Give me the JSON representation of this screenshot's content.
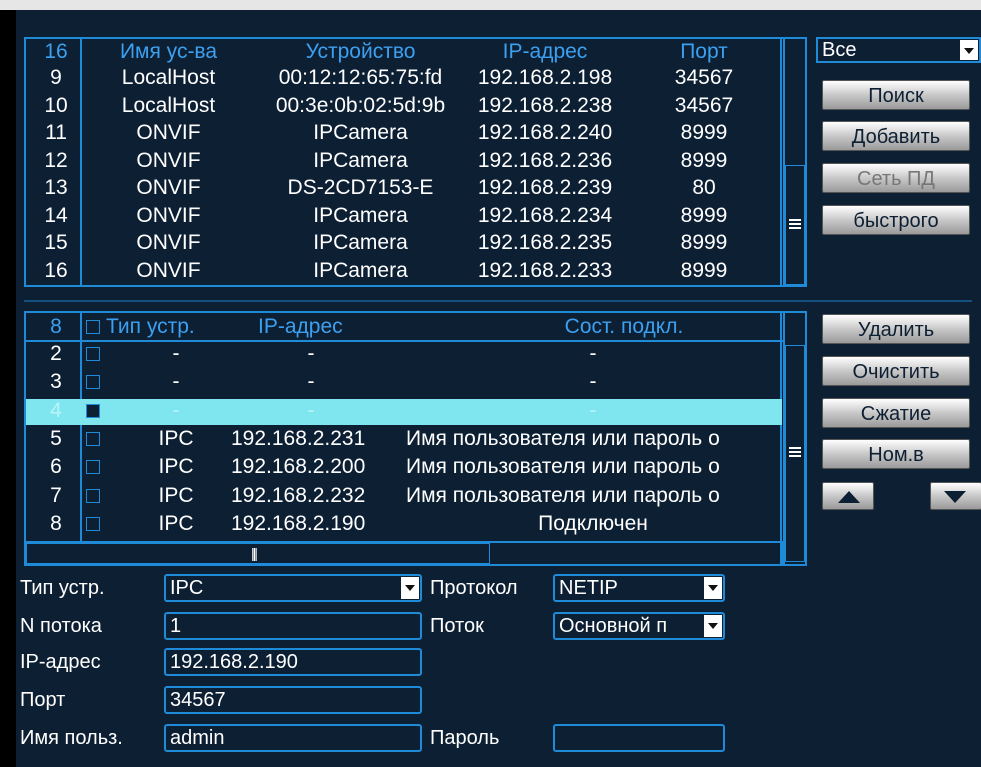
{
  "search_table": {
    "headers": {
      "num": "16",
      "name": "Имя ус-ва",
      "device": "Устройство",
      "ip": "IP-адрес",
      "port": "Порт"
    },
    "rows": [
      {
        "num": "9",
        "name": "LocalHost",
        "device": "00:12:12:65:75:fd",
        "ip": "192.168.2.198",
        "port": "34567"
      },
      {
        "num": "10",
        "name": "LocalHost",
        "device": "00:3e:0b:02:5d:9b",
        "ip": "192.168.2.238",
        "port": "34567"
      },
      {
        "num": "11",
        "name": "ONVIF",
        "device": "IPCamera",
        "ip": "192.168.2.240",
        "port": "8999"
      },
      {
        "num": "12",
        "name": "ONVIF",
        "device": "IPCamera",
        "ip": "192.168.2.236",
        "port": "8999"
      },
      {
        "num": "13",
        "name": "ONVIF",
        "device": "DS-2CD7153-E",
        "ip": "192.168.2.239",
        "port": "80"
      },
      {
        "num": "14",
        "name": "ONVIF",
        "device": "IPCamera",
        "ip": "192.168.2.234",
        "port": "8999"
      },
      {
        "num": "15",
        "name": "ONVIF",
        "device": "IPCamera",
        "ip": "192.168.2.235",
        "port": "8999"
      },
      {
        "num": "16",
        "name": "ONVIF",
        "device": "IPCamera",
        "ip": "192.168.2.233",
        "port": "8999"
      }
    ]
  },
  "right_top": {
    "filter_value": "Все",
    "search_label": "Поиск",
    "add_label": "Добавить",
    "network_label": "Сеть ПД",
    "quick_label": "быстрого"
  },
  "added_table": {
    "headers": {
      "num": "8",
      "type": "Тип устр.",
      "ip": "IP-адрес",
      "status": "Сост. подкл."
    },
    "rows": [
      {
        "num": "2",
        "type": "-",
        "ip": "-",
        "status": "-"
      },
      {
        "num": "3",
        "type": "-",
        "ip": "-",
        "status": "-"
      },
      {
        "num": "4",
        "type": "-",
        "ip": "-",
        "status": "-"
      },
      {
        "num": "5",
        "type": "IPC",
        "ip": "192.168.2.231",
        "status": "Имя пользователя или пароль о"
      },
      {
        "num": "6",
        "type": "IPC",
        "ip": "192.168.2.200",
        "status": "Имя пользователя или пароль о"
      },
      {
        "num": "7",
        "type": "IPC",
        "ip": "192.168.2.232",
        "status": "Имя пользователя или пароль о"
      },
      {
        "num": "8",
        "type": "IPC",
        "ip": "192.168.2.190",
        "status": "Подключен"
      }
    ],
    "selected_row_num": "4",
    "hscroll_grip": "|||"
  },
  "right_bottom": {
    "delete_label": "Удалить",
    "clear_label": "Очистить",
    "compress_label": "Сжатие",
    "num_label": "Ном.в",
    "up_icon": "up-arrow-icon",
    "down_icon": "down-arrow-icon"
  },
  "form": {
    "device_type_label": "Тип устр.",
    "device_type_value": "IPC",
    "protocol_label": "Протокол",
    "protocol_value": "NETIP",
    "stream_count_label": "N потока",
    "stream_count_value": "1",
    "stream_label": "Поток",
    "stream_value": "Основной п",
    "ip_label": "IP-адрес",
    "ip_value": "192.168.2.190",
    "port_label": "Порт",
    "port_value": "34567",
    "user_label": "Имя польз.",
    "user_value": "admin",
    "password_label": "Пароль",
    "password_value": ""
  },
  "colors": {
    "background": "#0d1f33",
    "border": "#1e8ad8",
    "header_text": "#3ca0f0",
    "selected_row": "#7fe6f0"
  }
}
